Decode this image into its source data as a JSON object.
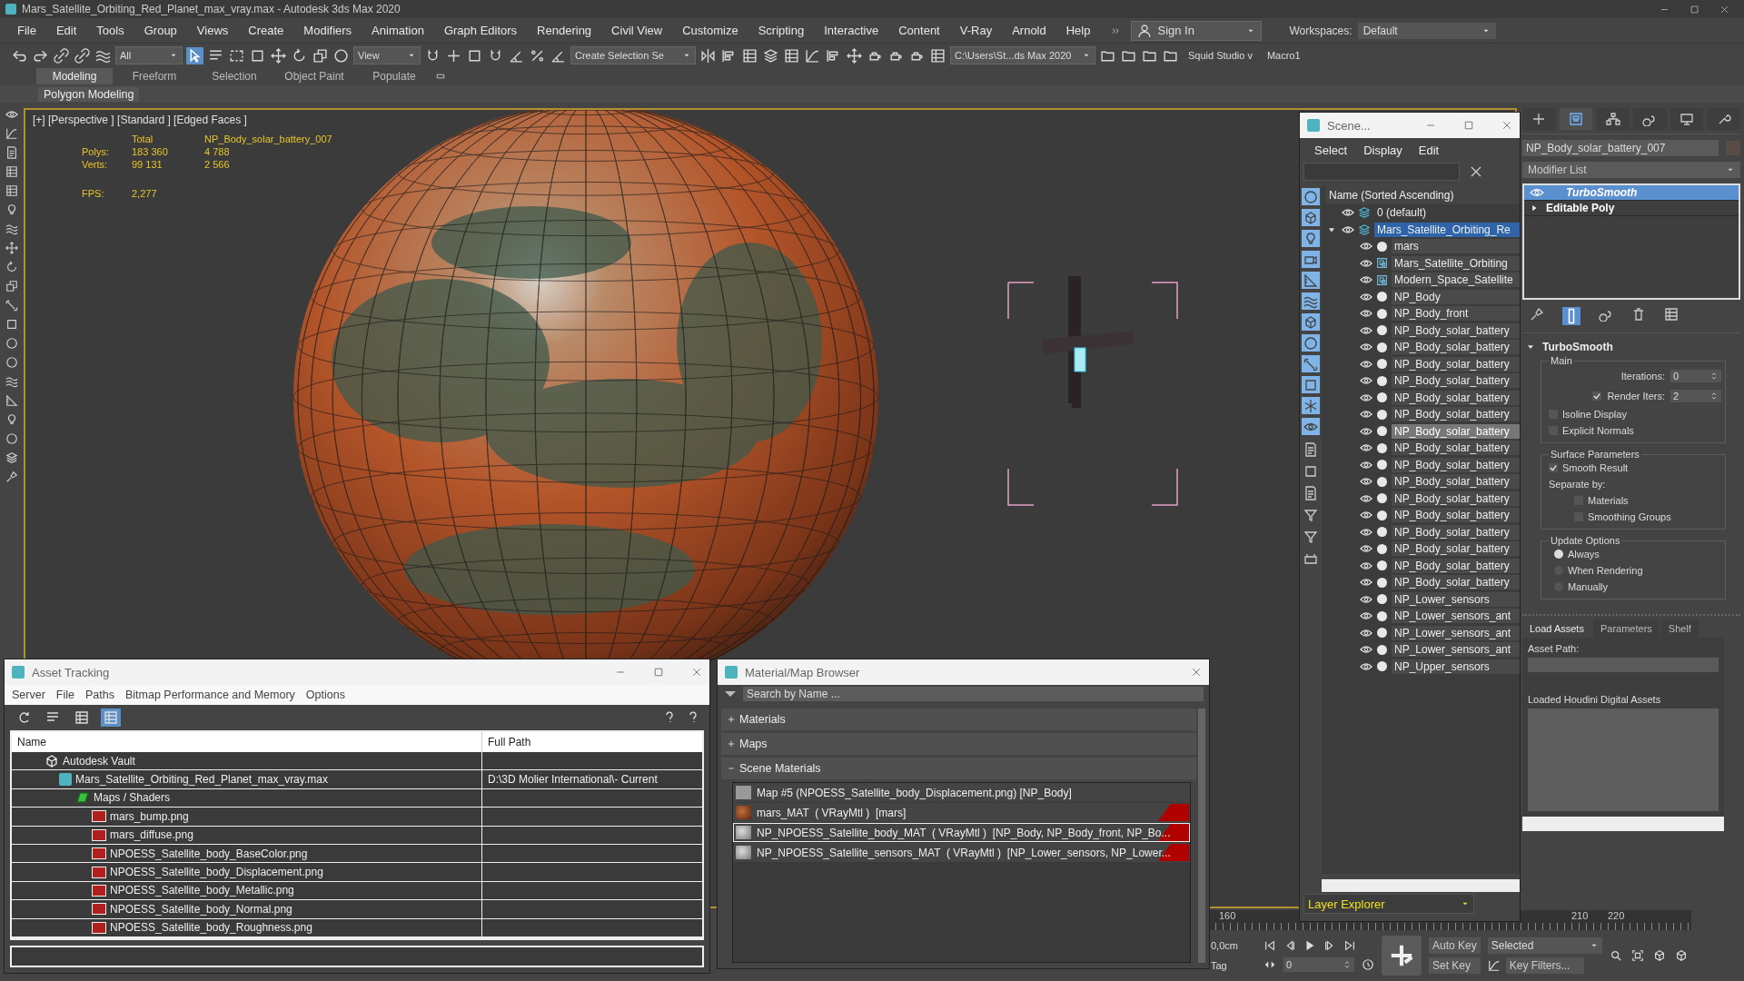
{
  "window": {
    "title": "Mars_Satellite_Orbiting_Red_Planet_max_vray.max - Autodesk 3ds Max 2020"
  },
  "menu": [
    "File",
    "Edit",
    "Tools",
    "Group",
    "Views",
    "Create",
    "Modifiers",
    "Animation",
    "Graph Editors",
    "Rendering",
    "Civil View",
    "Customize",
    "Scripting",
    "Interactive",
    "Content",
    "V-Ray",
    "Arnold",
    "Help"
  ],
  "sign_in": "Sign In",
  "workspaces": {
    "label": "Workspaces:",
    "value": "Default"
  },
  "toolbar": {
    "selection_filter": "All",
    "reference_coordinate": "View",
    "selection_set": "Create Selection Se",
    "project_path": "C:\\Users\\St...ds Max 2020",
    "plugins": [
      "Squid Studio v",
      "Macro1"
    ]
  },
  "ribbon": {
    "tabs": [
      {
        "label": "Modeling",
        "selected": true
      },
      {
        "label": "Freeform",
        "selected": false
      },
      {
        "label": "Selection",
        "selected": false
      },
      {
        "label": "Object Paint",
        "selected": false
      },
      {
        "label": "Populate",
        "selected": false
      }
    ],
    "panel": "Polygon Modeling"
  },
  "viewport": {
    "label": "[+] [Perspective ] [Standard ] [Edged Faces ]",
    "stats": {
      "headers": [
        "Total",
        "NP_Body_solar_battery_007"
      ],
      "rows": [
        {
          "label": "Polys:",
          "total": "183 360",
          "selection": "4 788"
        },
        {
          "label": "Verts:",
          "total": "99 131",
          "selection": "2 566"
        }
      ],
      "fps": {
        "label": "FPS:",
        "value": "2,277"
      }
    }
  },
  "scene_explorer": {
    "title": "Scene...",
    "menu": [
      "Select",
      "Display",
      "Edit"
    ],
    "filters": [
      {
        "on": true
      },
      {
        "on": true
      },
      {
        "on": true
      },
      {
        "on": true
      },
      {
        "on": true
      },
      {
        "on": true
      },
      {
        "on": true
      },
      {
        "on": true
      },
      {
        "on": true
      },
      {
        "on": true
      },
      {
        "on": true
      },
      {
        "on": true
      }
    ],
    "column": "Name (Sorted Ascending)",
    "tree": [
      {
        "name": "0 (default)",
        "kind": "layer",
        "selected": false
      },
      {
        "name": "Mars_Satellite_Orbiting_Re",
        "kind": "layer",
        "selected": true,
        "expanded": true,
        "children": [
          {
            "name": "mars",
            "kind": "object",
            "selected": false
          },
          {
            "name": "Mars_Satellite_Orbiting",
            "kind": "container",
            "selected": false
          },
          {
            "name": "Modern_Space_Satellite",
            "kind": "container",
            "selected": false
          },
          {
            "name": "NP_Body",
            "kind": "object",
            "selected": false
          },
          {
            "name": "NP_Body_front",
            "kind": "object",
            "selected": false
          },
          {
            "name": "NP_Body_solar_battery",
            "kind": "object",
            "selected": false
          },
          {
            "name": "NP_Body_solar_battery",
            "kind": "object",
            "selected": false
          },
          {
            "name": "NP_Body_solar_battery",
            "kind": "object",
            "selected": false
          },
          {
            "name": "NP_Body_solar_battery",
            "kind": "object",
            "selected": false
          },
          {
            "name": "NP_Body_solar_battery",
            "kind": "object",
            "selected": false
          },
          {
            "name": "NP_Body_solar_battery",
            "kind": "object",
            "selected": false
          },
          {
            "name": "NP_Body_solar_battery",
            "kind": "object",
            "selected": true
          },
          {
            "name": "NP_Body_solar_battery",
            "kind": "object",
            "selected": false
          },
          {
            "name": "NP_Body_solar_battery",
            "kind": "object",
            "selected": false
          },
          {
            "name": "NP_Body_solar_battery",
            "kind": "object",
            "selected": false
          },
          {
            "name": "NP_Body_solar_battery",
            "kind": "object",
            "selected": false
          },
          {
            "name": "NP_Body_solar_battery",
            "kind": "object",
            "selected": false
          },
          {
            "name": "NP_Body_solar_battery",
            "kind": "object",
            "selected": false
          },
          {
            "name": "NP_Body_solar_battery",
            "kind": "object",
            "selected": false
          },
          {
            "name": "NP_Body_solar_battery",
            "kind": "object",
            "selected": false
          },
          {
            "name": "NP_Body_solar_battery",
            "kind": "object",
            "selected": false
          },
          {
            "name": "NP_Lower_sensors",
            "kind": "object",
            "selected": false
          },
          {
            "name": "NP_Lower_sensors_ant",
            "kind": "object",
            "selected": false
          },
          {
            "name": "NP_Lower_sensors_ant",
            "kind": "object",
            "selected": false
          },
          {
            "name": "NP_Lower_sensors_ant",
            "kind": "object",
            "selected": false
          },
          {
            "name": "NP_Upper_sensors",
            "kind": "object",
            "selected": false
          }
        ]
      }
    ],
    "footer": "Layer Explorer"
  },
  "command_panel": {
    "tabs": [
      {
        "selected": false
      },
      {
        "selected": true
      },
      {
        "selected": false
      },
      {
        "selected": false
      },
      {
        "selected": false
      },
      {
        "selected": false
      }
    ],
    "object_name": "NP_Body_solar_battery_007",
    "modifier_list": "Modifier List",
    "stack": [
      {
        "name": "TurboSmooth",
        "kind": "modifier",
        "selected": true
      },
      {
        "name": "Editable Poly",
        "kind": "base",
        "selected": false
      }
    ],
    "rollout": {
      "title": "TurboSmooth",
      "main": {
        "title": "Main",
        "iterations": {
          "label": "Iterations:",
          "value": "0"
        },
        "render_iters": {
          "label": "Render Iters:",
          "value": "2",
          "checked": true
        },
        "options": [
          {
            "label": "Isoline Display",
            "checked": false
          },
          {
            "label": "Explicit Normals",
            "checked": false
          }
        ]
      },
      "surface": {
        "title": "Surface Parameters",
        "smooth_result": {
          "label": "Smooth Result",
          "checked": true
        },
        "separate_by": "Separate by:",
        "options": [
          {
            "label": "Materials",
            "checked": false
          },
          {
            "label": "Smoothing Groups",
            "checked": false
          }
        ]
      },
      "update": {
        "title": "Update Options",
        "options": [
          {
            "label": "Always",
            "selected": true
          },
          {
            "label": "When Rendering",
            "selected": false
          },
          {
            "label": "Manually",
            "selected": false
          }
        ]
      }
    },
    "houdini": {
      "tabs": [
        {
          "label": "Load Assets",
          "selected": true
        },
        {
          "label": "Parameters",
          "selected": false
        },
        {
          "label": "Shelf",
          "selected": false
        }
      ],
      "asset_path_label": "Asset Path:",
      "loaded_label": "Loaded Houdini Digital Assets"
    }
  },
  "asset_tracking": {
    "title": "Asset Tracking",
    "menu": [
      "Server",
      "File",
      "Paths",
      "Bitmap Performance and Memory",
      "Options"
    ],
    "view_buttons": [
      {
        "selected": false
      },
      {
        "selected": false
      },
      {
        "selected": false
      },
      {
        "selected": true
      }
    ],
    "columns": [
      "Name",
      "Full Path"
    ],
    "tree": [
      {
        "name": "Autodesk Vault",
        "kind": "vault",
        "children": [
          {
            "name": "Mars_Satellite_Orbiting_Red_Planet_max_vray.max",
            "path": "D:\\3D Molier International\\- Current",
            "kind": "scene",
            "children": [
              {
                "name": "Maps / Shaders",
                "kind": "folder",
                "children": [
                  {
                    "name": "mars_bump.png",
                    "kind": "png"
                  },
                  {
                    "name": "mars_diffuse.png",
                    "kind": "png"
                  },
                  {
                    "name": "NPOESS_Satellite_body_BaseColor.png",
                    "kind": "png"
                  },
                  {
                    "name": "NPOESS_Satellite_body_Displacement.png",
                    "kind": "png"
                  },
                  {
                    "name": "NPOESS_Satellite_body_Metallic.png",
                    "kind": "png"
                  },
                  {
                    "name": "NPOESS_Satellite_body_Normal.png",
                    "kind": "png"
                  },
                  {
                    "name": "NPOESS_Satellite_body_Roughness.png",
                    "kind": "png"
                  }
                ]
              }
            ]
          }
        ]
      }
    ]
  },
  "material_browser": {
    "title": "Material/Map Browser",
    "search": {
      "placeholder": "Search by Name ..."
    },
    "groups": [
      {
        "label": "Materials",
        "expanded": false
      },
      {
        "label": "Maps",
        "expanded": false
      },
      {
        "label": "Scene Materials",
        "expanded": true,
        "items": [
          {
            "label": "Map #5 (NPOESS_Satellite_body_Displacement.png) [NP_Body]",
            "kind": "map",
            "selected": false,
            "flagged": false
          },
          {
            "label": "mars_MAT  ( VRayMtl )  [mars]",
            "kind": "planet",
            "selected": false,
            "flagged": true
          },
          {
            "label": "NP_NPOESS_Satellite_body_MAT  ( VRayMtl )  [NP_Body, NP_Body_front, NP_Bo...",
            "kind": "material",
            "selected": true,
            "flagged": true
          },
          {
            "label": "NP_NPOESS_Satellite_sensors_MAT  ( VRayMtl )  [NP_Lower_sensors, NP_Lower...",
            "kind": "material",
            "selected": false,
            "flagged": true
          }
        ]
      }
    ]
  },
  "timeline": {
    "ticks": [
      "160",
      "210",
      "220"
    ],
    "coordinate": "0,0cm",
    "tag": "Tag",
    "frame": "0",
    "auto_key": "Auto Key",
    "set_key": "Set Key",
    "key_mode": "Selected",
    "key_filters": "Key Filters..."
  }
}
